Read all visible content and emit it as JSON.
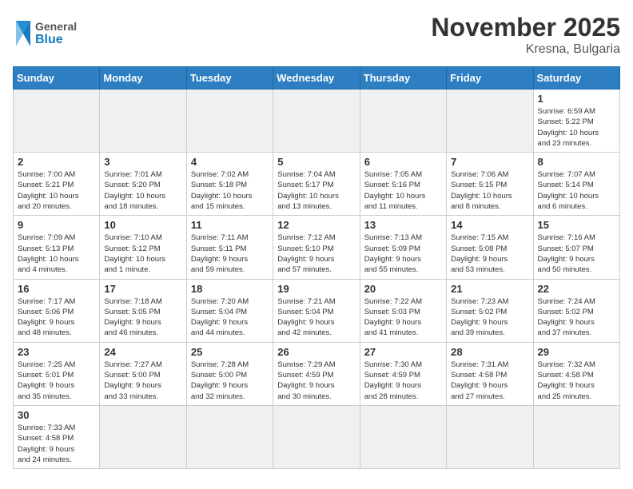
{
  "header": {
    "title": "November 2025",
    "subtitle": "Kresna, Bulgaria",
    "logo_general": "General",
    "logo_blue": "Blue"
  },
  "weekdays": [
    "Sunday",
    "Monday",
    "Tuesday",
    "Wednesday",
    "Thursday",
    "Friday",
    "Saturday"
  ],
  "days": [
    {
      "num": "",
      "info": "",
      "empty": true
    },
    {
      "num": "",
      "info": "",
      "empty": true
    },
    {
      "num": "",
      "info": "",
      "empty": true
    },
    {
      "num": "",
      "info": "",
      "empty": true
    },
    {
      "num": "",
      "info": "",
      "empty": true
    },
    {
      "num": "",
      "info": "",
      "empty": true
    },
    {
      "num": "1",
      "info": "Sunrise: 6:59 AM\nSunset: 5:22 PM\nDaylight: 10 hours\nand 23 minutes."
    },
    {
      "num": "2",
      "info": "Sunrise: 7:00 AM\nSunset: 5:21 PM\nDaylight: 10 hours\nand 20 minutes."
    },
    {
      "num": "3",
      "info": "Sunrise: 7:01 AM\nSunset: 5:20 PM\nDaylight: 10 hours\nand 18 minutes."
    },
    {
      "num": "4",
      "info": "Sunrise: 7:02 AM\nSunset: 5:18 PM\nDaylight: 10 hours\nand 15 minutes."
    },
    {
      "num": "5",
      "info": "Sunrise: 7:04 AM\nSunset: 5:17 PM\nDaylight: 10 hours\nand 13 minutes."
    },
    {
      "num": "6",
      "info": "Sunrise: 7:05 AM\nSunset: 5:16 PM\nDaylight: 10 hours\nand 11 minutes."
    },
    {
      "num": "7",
      "info": "Sunrise: 7:06 AM\nSunset: 5:15 PM\nDaylight: 10 hours\nand 8 minutes."
    },
    {
      "num": "8",
      "info": "Sunrise: 7:07 AM\nSunset: 5:14 PM\nDaylight: 10 hours\nand 6 minutes."
    },
    {
      "num": "9",
      "info": "Sunrise: 7:09 AM\nSunset: 5:13 PM\nDaylight: 10 hours\nand 4 minutes."
    },
    {
      "num": "10",
      "info": "Sunrise: 7:10 AM\nSunset: 5:12 PM\nDaylight: 10 hours\nand 1 minute."
    },
    {
      "num": "11",
      "info": "Sunrise: 7:11 AM\nSunset: 5:11 PM\nDaylight: 9 hours\nand 59 minutes."
    },
    {
      "num": "12",
      "info": "Sunrise: 7:12 AM\nSunset: 5:10 PM\nDaylight: 9 hours\nand 57 minutes."
    },
    {
      "num": "13",
      "info": "Sunrise: 7:13 AM\nSunset: 5:09 PM\nDaylight: 9 hours\nand 55 minutes."
    },
    {
      "num": "14",
      "info": "Sunrise: 7:15 AM\nSunset: 5:08 PM\nDaylight: 9 hours\nand 53 minutes."
    },
    {
      "num": "15",
      "info": "Sunrise: 7:16 AM\nSunset: 5:07 PM\nDaylight: 9 hours\nand 50 minutes."
    },
    {
      "num": "16",
      "info": "Sunrise: 7:17 AM\nSunset: 5:06 PM\nDaylight: 9 hours\nand 48 minutes."
    },
    {
      "num": "17",
      "info": "Sunrise: 7:18 AM\nSunset: 5:05 PM\nDaylight: 9 hours\nand 46 minutes."
    },
    {
      "num": "18",
      "info": "Sunrise: 7:20 AM\nSunset: 5:04 PM\nDaylight: 9 hours\nand 44 minutes."
    },
    {
      "num": "19",
      "info": "Sunrise: 7:21 AM\nSunset: 5:04 PM\nDaylight: 9 hours\nand 42 minutes."
    },
    {
      "num": "20",
      "info": "Sunrise: 7:22 AM\nSunset: 5:03 PM\nDaylight: 9 hours\nand 41 minutes."
    },
    {
      "num": "21",
      "info": "Sunrise: 7:23 AM\nSunset: 5:02 PM\nDaylight: 9 hours\nand 39 minutes."
    },
    {
      "num": "22",
      "info": "Sunrise: 7:24 AM\nSunset: 5:02 PM\nDaylight: 9 hours\nand 37 minutes."
    },
    {
      "num": "23",
      "info": "Sunrise: 7:25 AM\nSunset: 5:01 PM\nDaylight: 9 hours\nand 35 minutes."
    },
    {
      "num": "24",
      "info": "Sunrise: 7:27 AM\nSunset: 5:00 PM\nDaylight: 9 hours\nand 33 minutes."
    },
    {
      "num": "25",
      "info": "Sunrise: 7:28 AM\nSunset: 5:00 PM\nDaylight: 9 hours\nand 32 minutes."
    },
    {
      "num": "26",
      "info": "Sunrise: 7:29 AM\nSunset: 4:59 PM\nDaylight: 9 hours\nand 30 minutes."
    },
    {
      "num": "27",
      "info": "Sunrise: 7:30 AM\nSunset: 4:59 PM\nDaylight: 9 hours\nand 28 minutes."
    },
    {
      "num": "28",
      "info": "Sunrise: 7:31 AM\nSunset: 4:58 PM\nDaylight: 9 hours\nand 27 minutes."
    },
    {
      "num": "29",
      "info": "Sunrise: 7:32 AM\nSunset: 4:58 PM\nDaylight: 9 hours\nand 25 minutes."
    },
    {
      "num": "30",
      "info": "Sunrise: 7:33 AM\nSunset: 4:58 PM\nDaylight: 9 hours\nand 24 minutes."
    },
    {
      "num": "",
      "info": "",
      "empty": true
    },
    {
      "num": "",
      "info": "",
      "empty": true
    },
    {
      "num": "",
      "info": "",
      "empty": true
    },
    {
      "num": "",
      "info": "",
      "empty": true
    },
    {
      "num": "",
      "info": "",
      "empty": true
    },
    {
      "num": "",
      "info": "",
      "empty": true
    }
  ]
}
